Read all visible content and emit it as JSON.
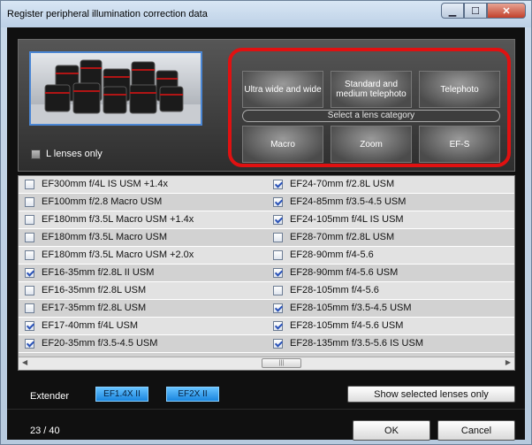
{
  "window": {
    "title": "Register peripheral illumination correction data",
    "buttons": [
      "minimize-icon",
      "maximize-icon",
      "close-icon"
    ]
  },
  "filter": {
    "l_lenses_label": "L lenses only",
    "l_lenses_checked": false
  },
  "categories": {
    "items": [
      "Ultra wide and wide",
      "Standard and\nmedium telephoto",
      "Telephoto",
      "Macro",
      "Zoom",
      "EF-S"
    ],
    "prompt": "Select a lens category",
    "highlight_color": "#e01111"
  },
  "lenses": {
    "left": [
      {
        "name": "EF300mm f/4L IS USM +1.4x",
        "checked": false
      },
      {
        "name": "EF100mm f/2.8 Macro USM",
        "checked": false
      },
      {
        "name": "EF180mm f/3.5L Macro USM +1.4x",
        "checked": false
      },
      {
        "name": "EF180mm f/3.5L Macro USM",
        "checked": false
      },
      {
        "name": "EF180mm f/3.5L Macro USM +2.0x",
        "checked": false
      },
      {
        "name": "EF16-35mm f/2.8L II USM",
        "checked": true
      },
      {
        "name": "EF16-35mm f/2.8L USM",
        "checked": false
      },
      {
        "name": "EF17-35mm f/2.8L USM",
        "checked": false
      },
      {
        "name": "EF17-40mm f/4L USM",
        "checked": true
      },
      {
        "name": "EF20-35mm f/3.5-4.5 USM",
        "checked": true
      }
    ],
    "right": [
      {
        "name": "EF24-70mm f/2.8L USM",
        "checked": true
      },
      {
        "name": "EF24-85mm f/3.5-4.5 USM",
        "checked": true
      },
      {
        "name": "EF24-105mm f/4L IS USM",
        "checked": true
      },
      {
        "name": "EF28-70mm f/2.8L USM",
        "checked": false
      },
      {
        "name": "EF28-90mm f/4-5.6",
        "checked": false
      },
      {
        "name": "EF28-90mm f/4-5.6 USM",
        "checked": true
      },
      {
        "name": "EF28-105mm f/4-5.6",
        "checked": false
      },
      {
        "name": "EF28-105mm f/3.5-4.5 USM",
        "checked": true
      },
      {
        "name": "EF28-105mm f/4-5.6 USM",
        "checked": true
      },
      {
        "name": "EF28-135mm f/3.5-5.6 IS USM",
        "checked": true
      }
    ]
  },
  "extender": {
    "label": "Extender",
    "buttons": [
      "EF1.4X II",
      "EF2X II"
    ],
    "color": "#1b86df"
  },
  "show_selected_label": "Show selected lenses only",
  "status": {
    "count": "23 / 40"
  },
  "footer": {
    "ok_label": "OK",
    "cancel_label": "Cancel"
  }
}
